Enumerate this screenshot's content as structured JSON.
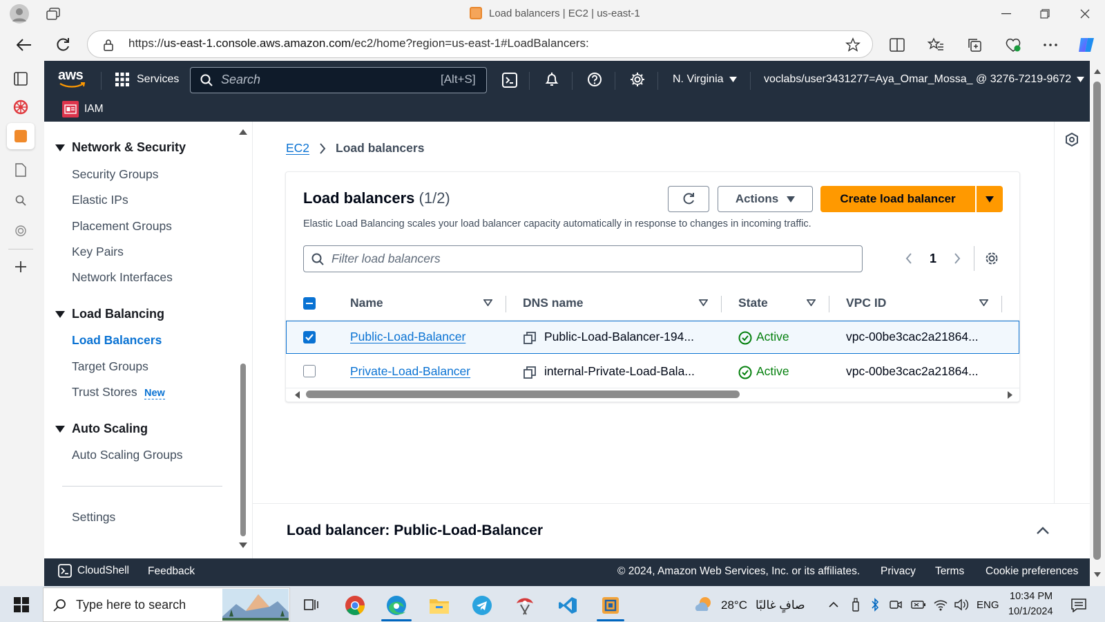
{
  "browser": {
    "tab_title": "Load balancers | EC2 | us-east-1",
    "url_prefix": "https://",
    "url_host": "us-east-1.console.aws.amazon.com",
    "url_path": "/ec2/home?region=us-east-1#LoadBalancers:"
  },
  "header": {
    "logo": "aws",
    "services": "Services",
    "search_placeholder": "Search",
    "search_shortcut": "[Alt+S]",
    "region": "N. Virginia",
    "account": "voclabs/user3431277=Aya_Omar_Mossa_ @ 3276-7219-9672",
    "favorite_label": "IAM",
    "colors": {
      "bar": "#232f3e",
      "iam_badge": "#dd344c"
    }
  },
  "sidebar": {
    "sections": [
      {
        "title": "Network & Security",
        "items": [
          "Security Groups",
          "Elastic IPs",
          "Placement Groups",
          "Key Pairs",
          "Network Interfaces"
        ]
      },
      {
        "title": "Load Balancing",
        "items": [
          "Load Balancers",
          "Target Groups",
          "Trust Stores"
        ]
      },
      {
        "title": "Auto Scaling",
        "items": [
          "Auto Scaling Groups"
        ]
      }
    ],
    "new_badge": "New",
    "settings": "Settings"
  },
  "breadcrumb": {
    "root": "EC2",
    "current": "Load balancers"
  },
  "panel": {
    "title": "Load balancers",
    "count": "(1/2)",
    "description": "Elastic Load Balancing scales your load balancer capacity automatically in response to changes in incoming traffic.",
    "actions_label": "Actions",
    "create_label": "Create load balancer",
    "filter_placeholder": "Filter load balancers",
    "page_number": "1",
    "columns": [
      "Name",
      "DNS name",
      "State",
      "VPC ID"
    ],
    "rows": [
      {
        "name": "Public-Load-Balancer",
        "dns": "Public-Load-Balancer-194...",
        "state": "Active",
        "vpc": "vpc-00be3cac2a21864...",
        "selected": true
      },
      {
        "name": "Private-Load-Balancer",
        "dns": "internal-Private-Load-Bala...",
        "state": "Active",
        "vpc": "vpc-00be3cac2a21864...",
        "selected": false
      }
    ],
    "accent": "#0972d3",
    "primary_color": "#ff9900",
    "success_color": "#037f0c"
  },
  "split_panel": {
    "title": "Load balancer: Public-Load-Balancer"
  },
  "footer": {
    "cloudshell": "CloudShell",
    "feedback": "Feedback",
    "copyright": "© 2024, Amazon Web Services, Inc. or its affiliates.",
    "privacy": "Privacy",
    "terms": "Terms",
    "cookie": "Cookie preferences"
  },
  "taskbar": {
    "search_placeholder": "Type here to search",
    "weather_temp": "28°C",
    "weather_desc": "صافٍ غالبًا",
    "lang": "ENG",
    "time": "10:34 PM",
    "date": "10/1/2024"
  }
}
